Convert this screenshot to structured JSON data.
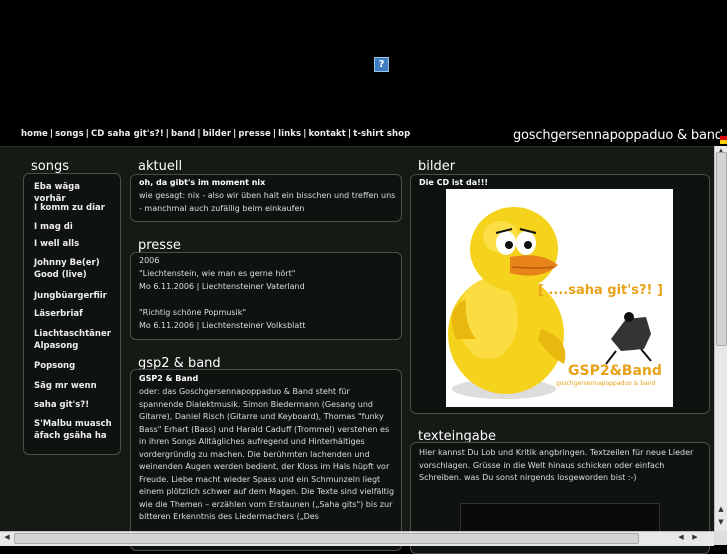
{
  "nav": [
    "home",
    "songs",
    "CD saha git's?!",
    "band",
    "bilder",
    "presse",
    "links",
    "kontakt",
    "t-shirt shop"
  ],
  "nav_separator": "|",
  "brand": "goschgersennapoppaduo & band",
  "missing_image_glyph": "?",
  "songs": {
    "title": "songs",
    "items": [
      "Eba wäga vorhär",
      "I komm zu diar",
      "I mag di",
      "I well alls",
      "Johnny Be(er) Good (live)",
      "Jungbüargerfiir",
      "Läserbriaf",
      "Liachtaschtäner Alpasong",
      "Popsong",
      "Säg mr wenn",
      "saha git's?!",
      "S'Malbu muasch äfach gsäha ha"
    ]
  },
  "aktuell": {
    "title": "aktuell",
    "heading": "oh, da gibt's im moment nix",
    "text": "wie gesagt: nix - also wir üben halt ein bisschen und treffen uns - manchmal auch zufällig beim einkaufen"
  },
  "presse": {
    "title": "presse",
    "year": "2006",
    "items": [
      {
        "quote": "\"Liechtenstein, wie man es gerne hört\"",
        "source": "Mo 6.11.2006 | Liechtensteiner Vaterland"
      },
      {
        "quote": "\"Richtig schöne Popmusik\"",
        "source": "Mo 6.11.2006 | Liechtensteiner Volksblatt"
      }
    ]
  },
  "gsp2": {
    "title": "gsp2 & band",
    "heading": "GSP2 & Band",
    "text": "oder: das Goschgersennapoppaduo & Band steht für spannende Dialektmusik. Simon Biedermann (Gesang und Gitarre), Daniel Risch (Gitarre und Keyboard), Thomas \"funky Bass\" Erhart (Bass) und Harald Caduff (Trommel) verstehen es in ihren Songs Alltägliches aufregend und Hinterhältiges vordergründig zu machen. Die berühmten lachenden und weinenden Augen werden bedient, der Kloss im Hals hüpft vor Freude. Liebe macht wieder Spass und ein Schmunzeln liegt einem plötzlich schwer auf dem Magen. Die Texte sind vielfältig wie die Themen – erzählen vom Erstaunen („Saha gits\") bis zur bitteren Erkenntnis des Liedermachers („Des"
  },
  "bilder": {
    "title": "bilder",
    "caption": "Die CD ist da!!!",
    "cover_slogan": "[ ....saha git's?! ]",
    "cover_band": "GSP2&Band",
    "cover_sub": "goschgersennapoppaduo & band"
  },
  "texteingabe": {
    "title": "texteingabe",
    "text": "Hier kannst Du Lob und Kritik angbringen. Textzeilen für neue Lieder vorschlagen. Grüsse in die Welt hinaus schicken oder einfach Schreiben. was Du sonst nirgends losgeworden bist :-)"
  },
  "colors": {
    "background": "#000000",
    "content": "#151a15",
    "box_border": "#4a4f4a",
    "duck": "#f5d21c",
    "cover_accent": "#e8a21a"
  }
}
